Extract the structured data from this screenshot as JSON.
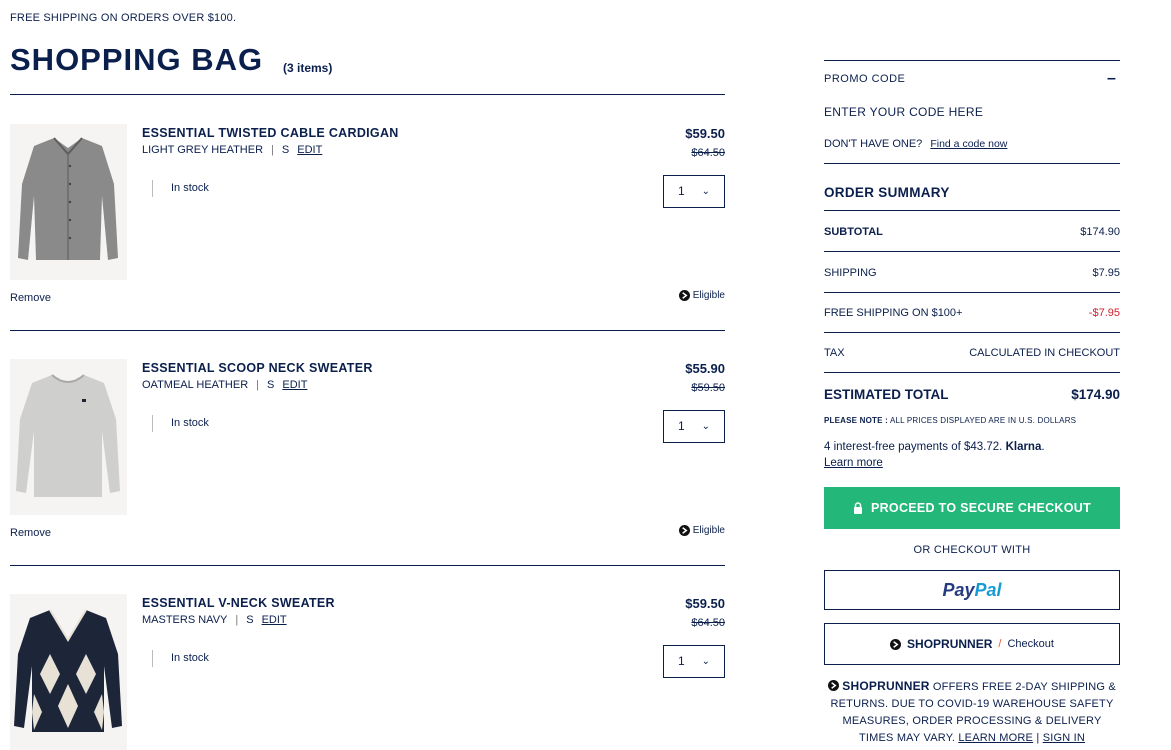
{
  "banner": "FREE SHIPPING ON ORDERS OVER $100.",
  "page": {
    "title": "SHOPPING BAG",
    "item_count": "(3 items)"
  },
  "items": [
    {
      "name": "ESSENTIAL TWISTED CABLE CARDIGAN",
      "color": "LIGHT GREY HEATHER",
      "size": "S",
      "edit_label": "EDIT",
      "stock": "In stock",
      "price": "$59.50",
      "original_price": "$64.50",
      "quantity": "1",
      "remove_label": "Remove",
      "eligible_label": "Eligible"
    },
    {
      "name": "ESSENTIAL SCOOP NECK SWEATER",
      "color": "OATMEAL HEATHER",
      "size": "S",
      "edit_label": "EDIT",
      "stock": "In stock",
      "price": "$55.90",
      "original_price": "$59.50",
      "quantity": "1",
      "remove_label": "Remove",
      "eligible_label": "Eligible"
    },
    {
      "name": "ESSENTIAL V-NECK SWEATER",
      "color": "MASTERS NAVY",
      "size": "S",
      "edit_label": "EDIT",
      "stock": "In stock",
      "price": "$59.50",
      "original_price": "$64.50",
      "quantity": "1"
    }
  ],
  "promo": {
    "label": "PROMO CODE",
    "toggle": "–",
    "input_placeholder": "ENTER YOUR CODE HERE",
    "help_text": "DON'T HAVE ONE?",
    "help_link": "Find a code now"
  },
  "summary": {
    "title": "ORDER SUMMARY",
    "subtotal_label": "SUBTOTAL",
    "subtotal_value": "$174.90",
    "shipping_label": "SHIPPING",
    "shipping_value": "$7.95",
    "free_shipping_label": "FREE SHIPPING ON $100+",
    "free_shipping_value": "-$7.95",
    "tax_label": "TAX",
    "tax_value": "CALCULATED IN CHECKOUT",
    "total_label": "ESTIMATED TOTAL",
    "total_value": "$174.90",
    "note_label": "PLEASE NOTE :",
    "note_text": "ALL PRICES DISPLAYED ARE IN U.S. DOLLARS"
  },
  "klarna": {
    "text": "4 interest-free payments of $43.72.",
    "brand": "Klarna",
    "period": ".",
    "learn_more": "Learn more"
  },
  "checkout": {
    "secure_label": "PROCEED TO SECURE CHECKOUT",
    "or_label": "OR CHECKOUT WITH",
    "paypal_pay": "Pay",
    "paypal_pal": "Pal",
    "shoprunner_brand": "SHOPRUNNER",
    "shoprunner_slash": "/",
    "shoprunner_action": "Checkout"
  },
  "shoprunner_info": {
    "brand": "SHOPRUNNER",
    "text": "OFFERS FREE 2-DAY SHIPPING & RETURNS. DUE TO COVID-19 WAREHOUSE SAFETY MEASURES, ORDER PROCESSING & DELIVERY TIMES MAY VARY.",
    "learn_more": "LEARN MORE",
    "separator": "|",
    "sign_in": "SIGN IN"
  },
  "colors": {
    "navy": "#0b1f4d",
    "checkout_green": "#23b87a",
    "discount_red": "#d1202f",
    "paypal_dark": "#253b80",
    "paypal_light": "#179bd7"
  },
  "icons": {
    "lock": "lock-icon",
    "shoprunner": "shoprunner-icon",
    "chevron": "chevron-down-icon"
  }
}
